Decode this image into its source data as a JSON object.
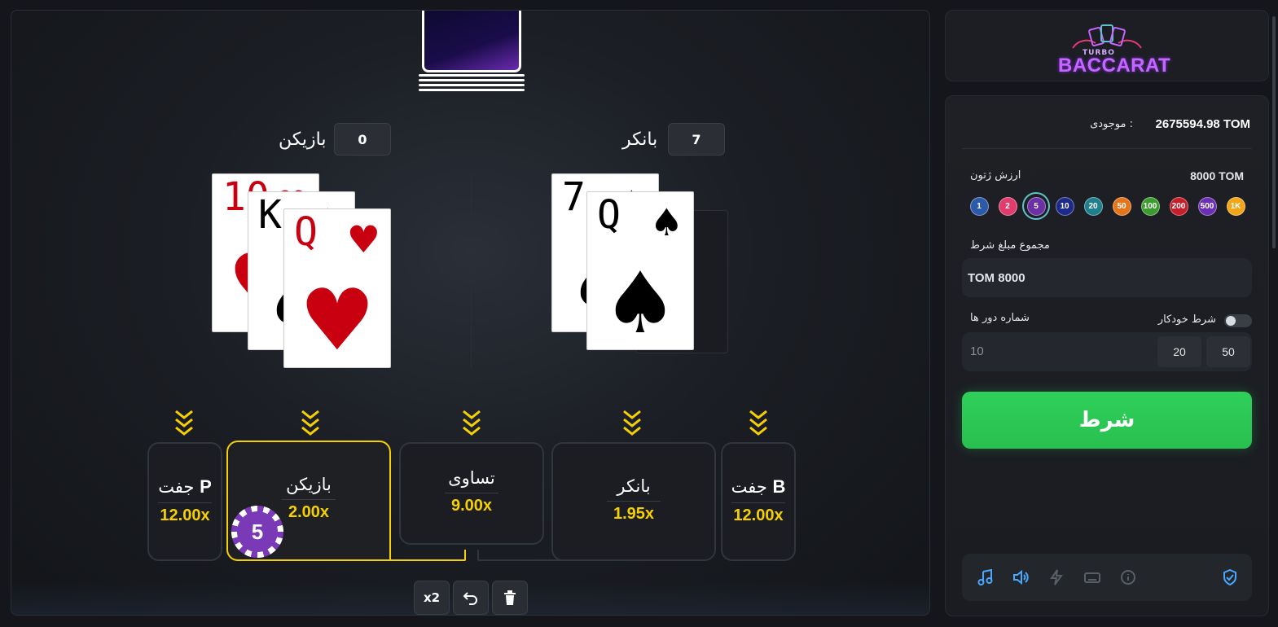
{
  "game": {
    "player_label": "بازیکن",
    "banker_label": "بانکر",
    "player_score": "0",
    "banker_score": "7",
    "player_cards": [
      {
        "rank": "10",
        "suit": "♥",
        "color": "red"
      },
      {
        "rank": "K",
        "suit": "♠",
        "color": "black"
      },
      {
        "rank": "Q",
        "suit": "♥",
        "color": "red"
      }
    ],
    "banker_cards": [
      {
        "rank": "7",
        "suit": "♠",
        "color": "black"
      },
      {
        "rank": "Q",
        "suit": "♠",
        "color": "black"
      }
    ]
  },
  "bets": {
    "player_pair": {
      "name": "جفت",
      "letter": "P",
      "odds": "12.00x"
    },
    "player": {
      "name": "بازیکن",
      "odds": "2.00x"
    },
    "tie": {
      "name": "تساوی",
      "odds": "9.00x"
    },
    "banker": {
      "name": "بانکر",
      "odds": "1.95x"
    },
    "banker_pair": {
      "name": "جفت",
      "letter": "B",
      "odds": "12.00x"
    },
    "placed_chip": "5"
  },
  "controls": {
    "double_label": "x2",
    "undo_icon": "undo-icon",
    "clear_icon": "trash-icon"
  },
  "sidebar": {
    "logo_small": "TURBO",
    "logo_word": "BACCARAT",
    "balance_label": "موجودی :",
    "balance_value": "2675594.98 TOM",
    "chip_value_label": "ارزش ژتون",
    "chip_value": "8000 TOM",
    "chips": [
      {
        "label": "1K",
        "color": "#f2a516"
      },
      {
        "label": "500",
        "color": "#6b2fb3"
      },
      {
        "label": "200",
        "color": "#c61f2b"
      },
      {
        "label": "100",
        "color": "#3c9b2e"
      },
      {
        "label": "50",
        "color": "#e4751b"
      },
      {
        "label": "20",
        "color": "#1f7f8c"
      },
      {
        "label": "10",
        "color": "#1c2a8a"
      },
      {
        "label": "5",
        "color": "#6b2fa6"
      },
      {
        "label": "2",
        "color": "#e23b6d"
      },
      {
        "label": "1",
        "color": "#2c5aa8"
      }
    ],
    "selected_chip": "5",
    "total_bet_label": "مجموع مبلغ شرط",
    "total_bet_value": "TOM 8000",
    "auto_bet_label": "شرط خودکار",
    "rounds_label": "شماره دور ها",
    "rounds_placeholder": "10",
    "round_options": [
      "50",
      "20"
    ],
    "bet_button": "شرط",
    "toolbar_icons": [
      "shield-icon",
      "info-icon",
      "keyboard-icon",
      "lightning-icon",
      "volume-icon",
      "music-icon"
    ],
    "accent_color": "#2fcf5a"
  }
}
